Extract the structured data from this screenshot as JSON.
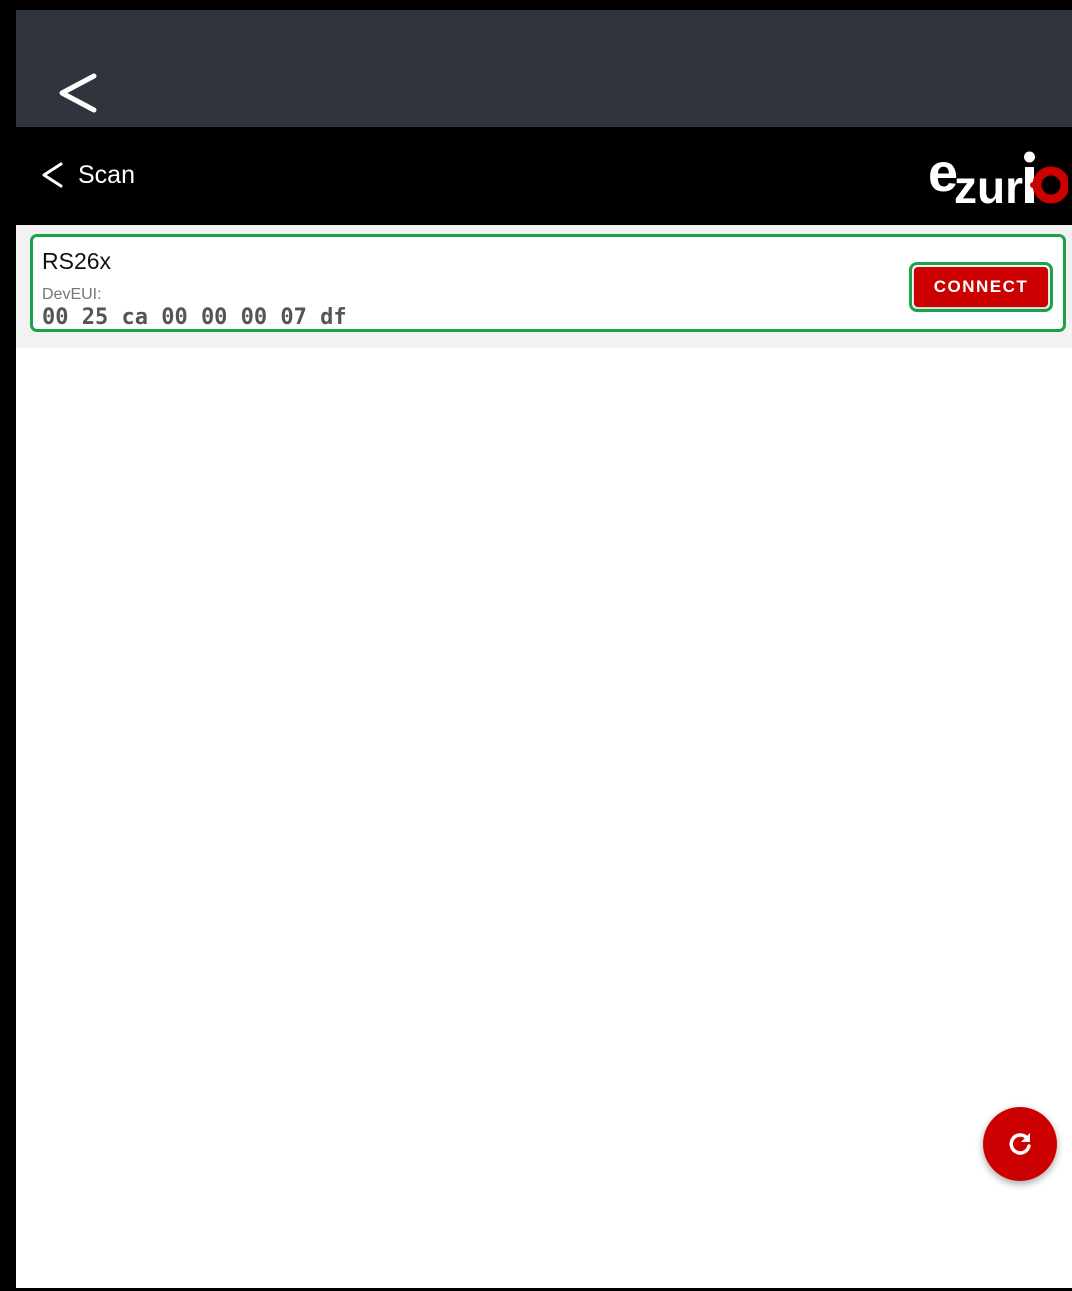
{
  "app_bar": {
    "back_label": "Scan",
    "brand_text": "ezurio"
  },
  "device_list": [
    {
      "name": "RS26x",
      "deveui_label": "DevEUI:",
      "deveui_value": "00 25 ca 00 00 00 07 df",
      "connect_label": "CONNECT"
    }
  ],
  "icons": {
    "system_back": "chevron-left-icon",
    "nav_back": "chevron-left-icon",
    "fab": "refresh-icon"
  },
  "colors": {
    "status_bar": "#30353d",
    "app_bar": "#000000",
    "accent": "#cc0000",
    "highlight": "#1aa34a"
  }
}
